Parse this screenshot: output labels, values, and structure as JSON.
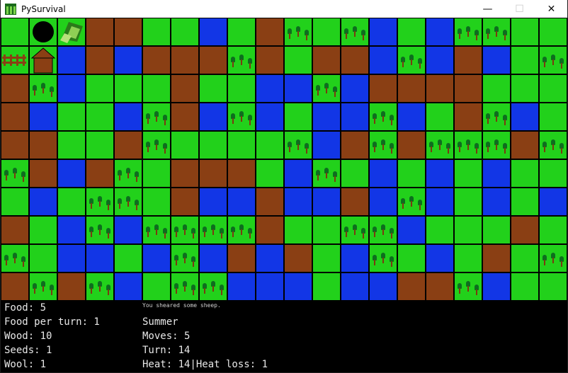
{
  "window": {
    "title": "PySurvival",
    "buttons": {
      "minimize": "—",
      "maximize": "☐",
      "close": "✕"
    }
  },
  "legend_colors": {
    "grass": "#22d11b",
    "dirt": "#8a3f14",
    "water": "#1236e6",
    "tree": "#0d6e1e"
  },
  "map": {
    "cols": 20,
    "rows": 10,
    "key": {
      "G": "grass",
      "D": "dirt",
      "W": "water",
      "F": "forest"
    },
    "rows_data": [
      "GGGDDGGWGDFGFWGWFFGG",
      "GGWDWDDDFDGDDWFWDWGF",
      "DFWGGGDGGWWFWDDDDGGG",
      "DWGGWFDWFWGWWFWGDFWG",
      "DDGGDFGGGGFWDFDFFFDF",
      "FDWDFGDDDGWFGWGWGWGG",
      "GWGFFGDWWDWWDWFWGWGW",
      "DGWFWFFFFDGGFFWGGGDG",
      "FGWWGWFWDWDGWFGWGDGF",
      "DFDFWGFFWWWGWWDDFWGG"
    ],
    "objects": [
      {
        "name": "player",
        "icon": "player-circle-icon",
        "col": 1,
        "row": 0
      },
      {
        "name": "sheep-pen",
        "icon": "sheep-pen-icon",
        "col": 2,
        "row": 0
      },
      {
        "name": "fence",
        "icon": "fence-icon",
        "col": 0,
        "row": 1
      },
      {
        "name": "house",
        "icon": "house-icon",
        "col": 1,
        "row": 1
      }
    ]
  },
  "hud": {
    "message": "You sheared some sheep.",
    "left": [
      "Food: 5",
      "Food per turn: 1",
      "Wood: 10",
      "Seeds: 1",
      "Wool: 1"
    ],
    "right": [
      "Summer",
      "Moves: 5",
      "Turn: 14",
      "Heat: 14|Heat loss: 1"
    ]
  }
}
